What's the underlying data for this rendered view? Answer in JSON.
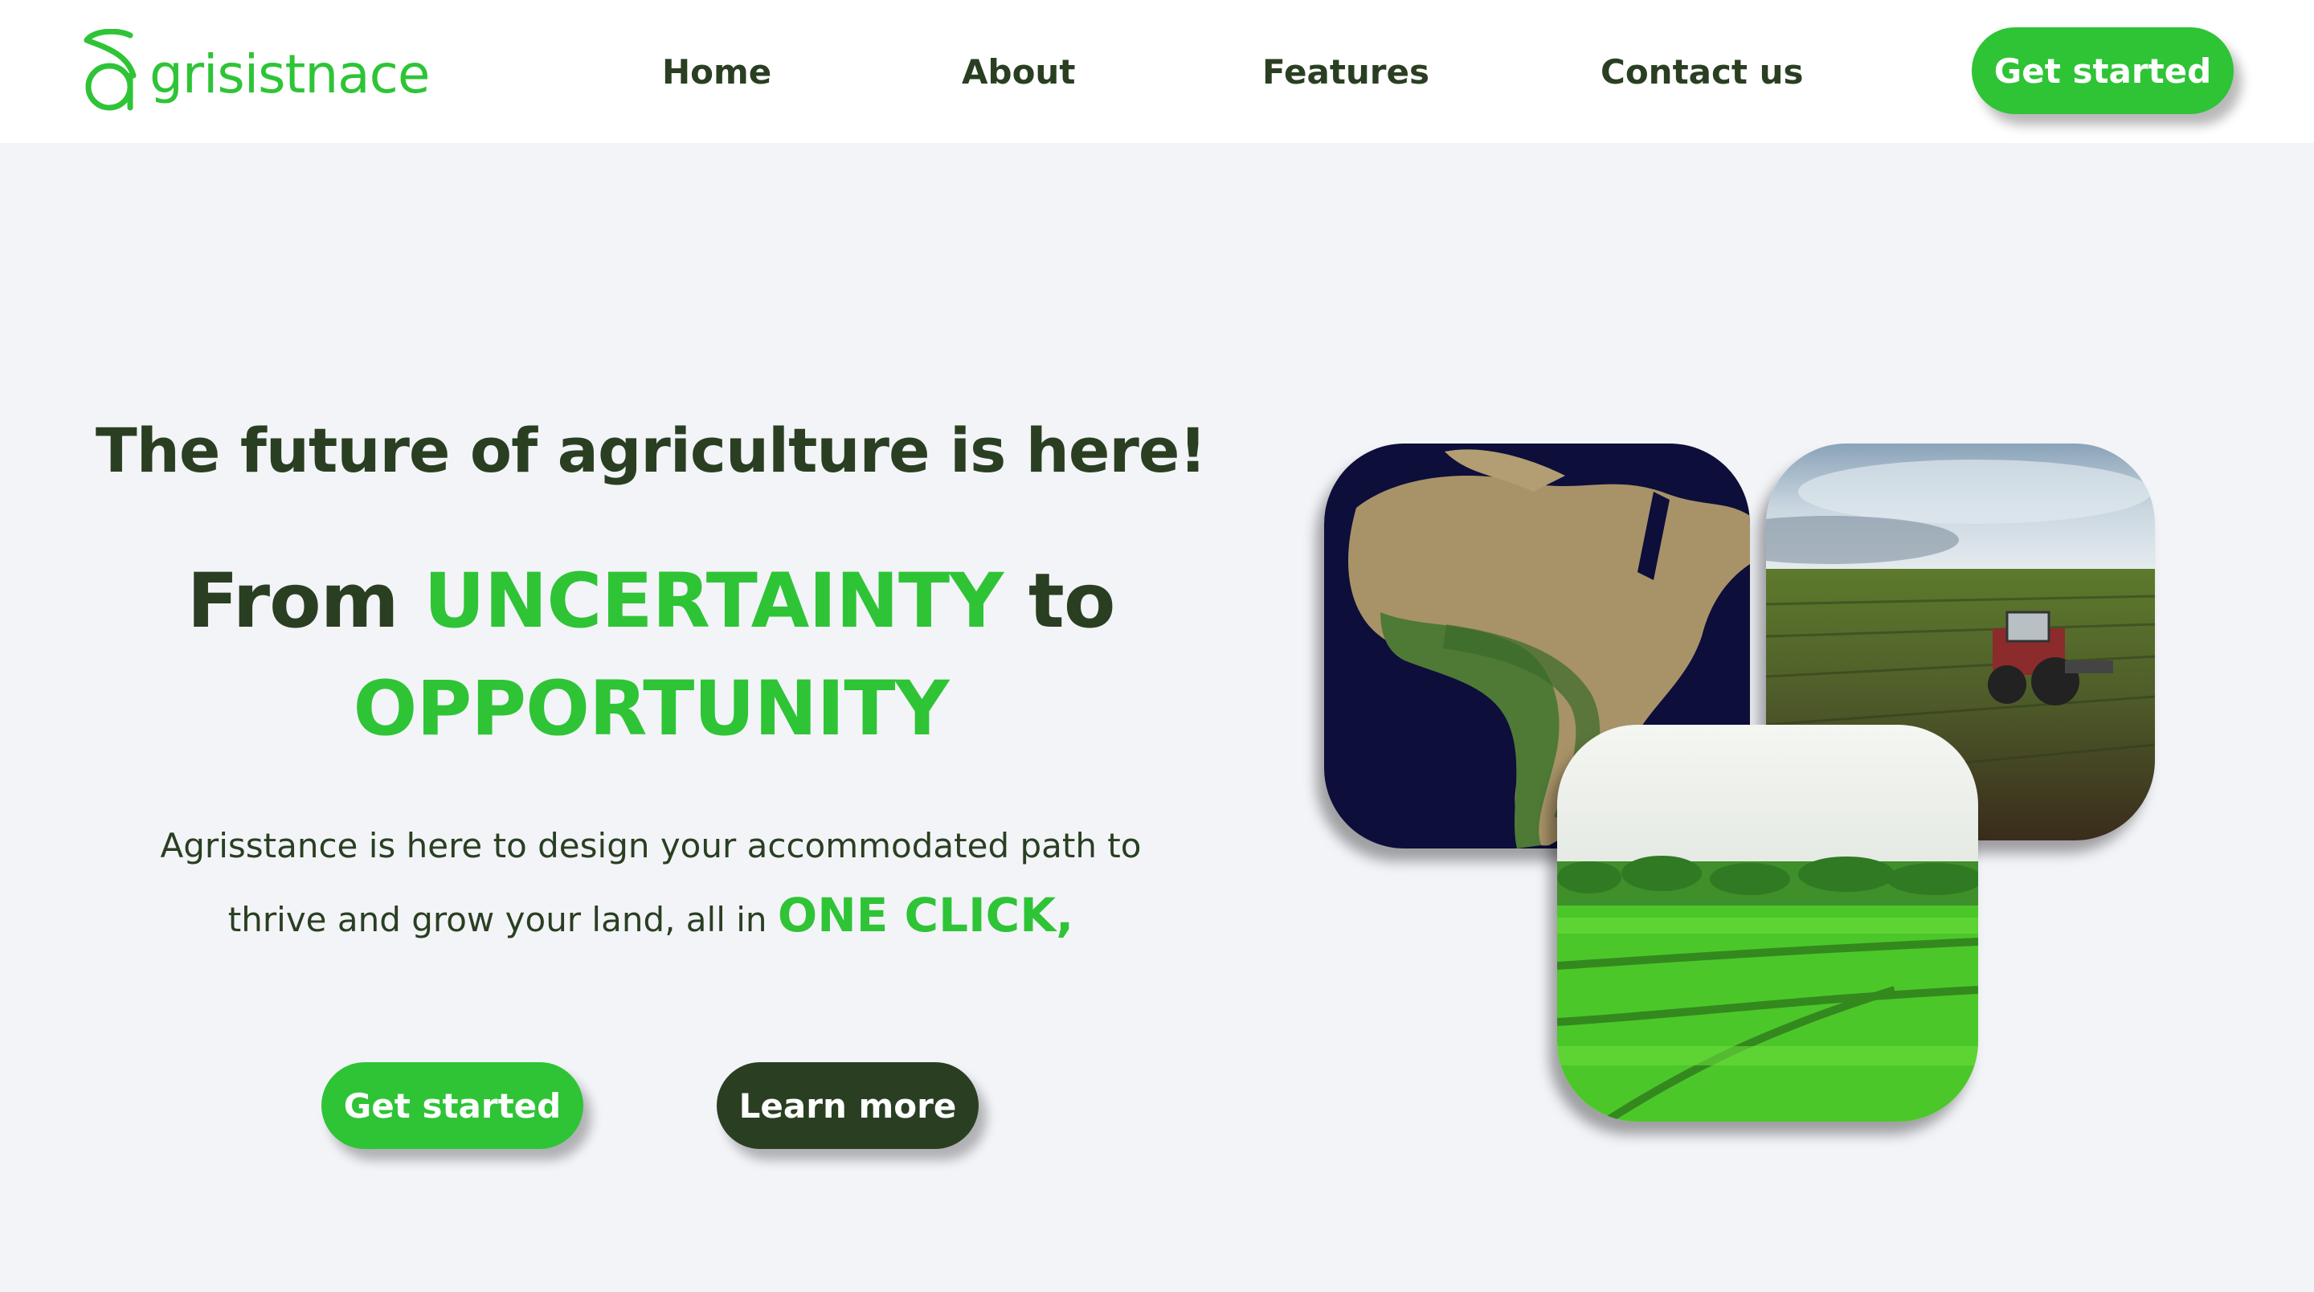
{
  "nav": {
    "logo_text": "grisistnace",
    "links": [
      "Home",
      "About",
      "Features",
      "Contact us"
    ],
    "cta_label": "Get started"
  },
  "hero": {
    "subtitle": "The future of agriculture is here!",
    "headline": {
      "part1": "From ",
      "highlight1": "UNCERTAINTY",
      "part2": " to",
      "highlight2": "OPPORTUNITY"
    },
    "description": {
      "line1": "Agrisstance is here to design your accommodated path to",
      "line2": "thrive and grow your land, all in ",
      "emphasis": "ONE CLICK,"
    },
    "primary_button": "Get started",
    "secondary_button": "Learn more"
  },
  "theme": {
    "brand_green": "#2ec436",
    "dark_green": "#2a3f22",
    "background": "#f3f4f8"
  },
  "images": [
    "africa-map-image",
    "tractor-field-image",
    "green-crops-image"
  ]
}
